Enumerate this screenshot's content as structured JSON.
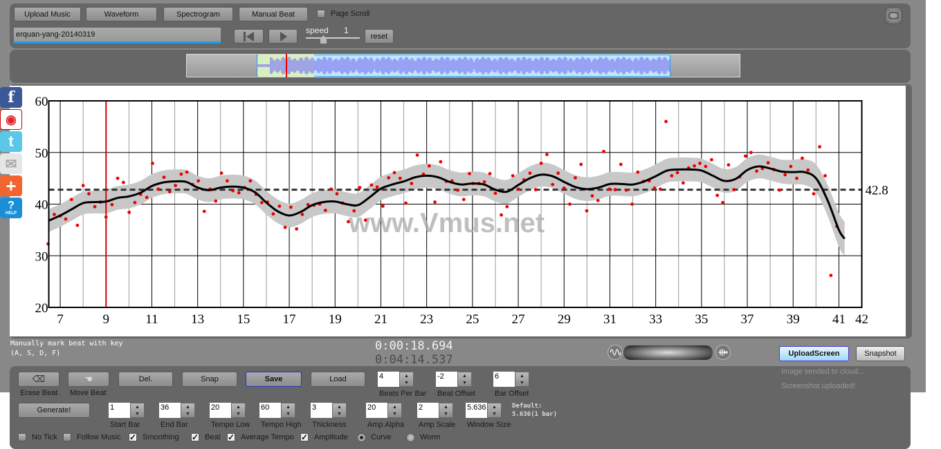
{
  "toolbar": {
    "upload_music": "Upload Music",
    "waveform": "Waveform",
    "spectrogram": "Spectrogram",
    "manual_beat": "Manual Beat",
    "page_scroll": {
      "label": "Page Scroll",
      "checked": false
    },
    "title_value": "erquan-yang-20140319",
    "speed_label": "speed",
    "speed_value": "1",
    "speed_fraction": 0.5,
    "reset": "reset"
  },
  "icons": [
    "skip-back-icon",
    "play-icon",
    "fullscreen-icon",
    "facebook-icon",
    "weibo-icon",
    "twitter-icon",
    "mail-icon",
    "plus-share-icon",
    "help-icon",
    "waveform-icon",
    "audio-wave-icon"
  ],
  "social": {
    "help_label": "HELP"
  },
  "status": {
    "hint_line1": "Manually mark beat with key",
    "hint_line2": "(A, S, D, F)",
    "current_time": "0:00:18.694",
    "total_time": "0:04:14.537",
    "upload_screen": "UploadScreen",
    "snapshot": "Snapshot",
    "msg1": "Image sended to cloud...",
    "msg2": "Screenshot uploaded!"
  },
  "controls": {
    "erase_beat": "Erase Beat",
    "move_beat": "Move Beat",
    "del": "Del.",
    "snap": "Snap",
    "save": "Save",
    "load": "Load",
    "generate": "Generate!",
    "spinners_row1": [
      {
        "label": "Beats Per Bar",
        "value": "4"
      },
      {
        "label": "Beat Offset",
        "value": "-2"
      },
      {
        "label": "Bar Offset",
        "value": "6"
      }
    ],
    "spinners_row2": [
      {
        "label": "Start Bar",
        "value": "1"
      },
      {
        "label": "End Bar",
        "value": "36"
      },
      {
        "label": "Tempo Low",
        "value": "20"
      },
      {
        "label": "Tempo High",
        "value": "60"
      },
      {
        "label": "Thickness",
        "value": "3"
      },
      {
        "label": "Amp Alpha",
        "value": "20"
      },
      {
        "label": "Amp Scale",
        "value": "2"
      },
      {
        "label": "Window Size",
        "value": "5.636"
      }
    ],
    "default_line1": "Default:",
    "default_line2": "5.636(1 bar)",
    "checks": [
      {
        "label": "No Tick",
        "checked": false
      },
      {
        "label": "Follow Music",
        "checked": false
      },
      {
        "label": "Smoothing",
        "checked": true
      },
      {
        "label": "Beat",
        "checked": true
      },
      {
        "label": "Average Tempo",
        "checked": true
      },
      {
        "label": "Amplitude",
        "checked": true
      }
    ],
    "radios": [
      {
        "label": "Curve",
        "selected": true
      },
      {
        "label": "Worm",
        "selected": false
      }
    ]
  },
  "chart_data": {
    "type": "scatter",
    "watermark": "www.Vmus.net",
    "xlim": [
      6.5,
      42
    ],
    "ylim": [
      20,
      60
    ],
    "xticks": [
      7,
      9,
      11,
      13,
      15,
      17,
      19,
      21,
      23,
      25,
      27,
      29,
      31,
      33,
      35,
      37,
      39,
      41,
      42
    ],
    "yticks": [
      20,
      30,
      40,
      50,
      60
    ],
    "grid": true,
    "cursor_bar": 9,
    "average_tempo": 42.8,
    "average_label": "42.8",
    "colors": {
      "points": "#ee0000",
      "curve": "#000000",
      "band": "#c8c8c8",
      "cursor": "#dd0000",
      "average": "#333333"
    },
    "curve": {
      "x": [
        6.5,
        7,
        7.5,
        8,
        8.5,
        9,
        9.5,
        10,
        10.5,
        11,
        11.5,
        12,
        12.5,
        13,
        13.5,
        14,
        14.5,
        15,
        15.5,
        16,
        16.5,
        17,
        17.5,
        18,
        18.5,
        19,
        19.5,
        20,
        20.5,
        21,
        21.5,
        22,
        22.5,
        23,
        23.5,
        24,
        24.5,
        25,
        25.5,
        26,
        26.5,
        27,
        27.5,
        28,
        28.5,
        29,
        29.5,
        30,
        30.5,
        31,
        31.5,
        32,
        32.5,
        33,
        33.5,
        34,
        34.5,
        35,
        35.5,
        36,
        36.5,
        37,
        37.5,
        38,
        38.5,
        39,
        39.5,
        40,
        40.5,
        41,
        41.25
      ],
      "y": [
        36.8,
        37.8,
        39,
        40.2,
        40.4,
        40.5,
        41.2,
        41.5,
        42.2,
        43.5,
        44.2,
        44.4,
        44.3,
        43.2,
        42.7,
        43.2,
        43.4,
        43.2,
        42.3,
        40.3,
        38.6,
        37.8,
        38.5,
        39.8,
        40.4,
        40.5,
        40,
        39.8,
        41.3,
        43,
        43.8,
        44.4,
        45.2,
        45.5,
        45.2,
        44.3,
        43.8,
        44,
        43.8,
        42.8,
        42.4,
        43.7,
        45,
        45.7,
        45.4,
        44.3,
        43.3,
        42.9,
        43.2,
        43.9,
        43.9,
        43.8,
        44.4,
        45.4,
        46.5,
        46.7,
        46.7,
        46.5,
        45.5,
        44.5,
        44.9,
        46.6,
        47.3,
        46.9,
        46.3,
        46.2,
        46.2,
        45,
        40.8,
        35,
        33.3
      ],
      "band_halfwidth": [
        2.2,
        2.2,
        2.2,
        2.2,
        2.2,
        2.3,
        2.3,
        2.3,
        2.3,
        2.3,
        2.3,
        2.3,
        2.3,
        2.3,
        2.3,
        2.3,
        2.3,
        2.3,
        2.3,
        2.3,
        2.3,
        2.3,
        2.3,
        2.3,
        2.3,
        2.3,
        2.3,
        2.3,
        2.3,
        2.3,
        2.3,
        2.3,
        2.3,
        2.3,
        2.3,
        2.3,
        2.3,
        2.3,
        2.3,
        2.3,
        2.3,
        2.3,
        2.3,
        2.3,
        2.3,
        2.3,
        2.3,
        2.3,
        2.3,
        2.3,
        2.3,
        2.3,
        2.3,
        2.3,
        2.3,
        2.3,
        2.3,
        2.3,
        2.3,
        2.3,
        2.3,
        2.3,
        2.3,
        2.3,
        2.3,
        2.4,
        2.5,
        2.7,
        3.0,
        3.3,
        3.3
      ]
    },
    "points": [
      [
        6.47,
        32.3
      ],
      [
        6.74,
        38.0
      ],
      [
        7.0,
        37.7
      ],
      [
        7.24,
        37.1
      ],
      [
        7.49,
        40.9
      ],
      [
        7.75,
        35.9
      ],
      [
        8.0,
        43.6
      ],
      [
        8.25,
        42.0
      ],
      [
        8.51,
        39.5
      ],
      [
        8.75,
        40.4
      ],
      [
        9.0,
        37.5
      ],
      [
        9.26,
        39.9
      ],
      [
        9.51,
        45.0
      ],
      [
        9.76,
        44.2
      ],
      [
        10.01,
        38.4
      ],
      [
        10.26,
        40.3
      ],
      [
        10.51,
        41.9
      ],
      [
        10.78,
        41.3
      ],
      [
        11.03,
        47.9
      ],
      [
        11.28,
        42.9
      ],
      [
        11.53,
        45.2
      ],
      [
        11.78,
        42.4
      ],
      [
        12.03,
        43.6
      ],
      [
        12.28,
        45.8
      ],
      [
        12.53,
        46.2
      ],
      [
        12.78,
        43.8
      ],
      [
        13.03,
        44.5
      ],
      [
        13.29,
        38.6
      ],
      [
        13.54,
        42.9
      ],
      [
        13.79,
        40.6
      ],
      [
        14.04,
        46.0
      ],
      [
        14.29,
        44.5
      ],
      [
        14.54,
        42.6
      ],
      [
        14.8,
        42.2
      ],
      [
        15.05,
        43.2
      ],
      [
        15.3,
        44.5
      ],
      [
        15.55,
        41.9
      ],
      [
        15.8,
        40.3
      ],
      [
        16.05,
        40.4
      ],
      [
        16.3,
        38.1
      ],
      [
        16.57,
        39.6
      ],
      [
        16.82,
        35.5
      ],
      [
        17.07,
        39.4
      ],
      [
        17.32,
        35.2
      ],
      [
        17.57,
        38.0
      ],
      [
        17.82,
        39.9
      ],
      [
        18.08,
        39.8
      ],
      [
        18.33,
        40.0
      ],
      [
        18.58,
        38.8
      ],
      [
        18.83,
        42.9
      ],
      [
        19.08,
        42.0
      ],
      [
        19.33,
        40.2
      ],
      [
        19.58,
        36.6
      ],
      [
        19.83,
        38.7
      ],
      [
        20.08,
        43.2
      ],
      [
        20.33,
        36.9
      ],
      [
        20.59,
        43.7
      ],
      [
        20.84,
        43.3
      ],
      [
        21.09,
        39.6
      ],
      [
        21.34,
        45.1
      ],
      [
        21.59,
        46.1
      ],
      [
        21.84,
        45.0
      ],
      [
        22.09,
        40.2
      ],
      [
        22.34,
        44.0
      ],
      [
        22.59,
        49.5
      ],
      [
        22.86,
        45.8
      ],
      [
        23.11,
        47.4
      ],
      [
        23.36,
        40.4
      ],
      [
        23.61,
        48.2
      ],
      [
        23.86,
        44.4
      ],
      [
        24.11,
        44.5
      ],
      [
        24.36,
        42.7
      ],
      [
        24.62,
        40.9
      ],
      [
        24.87,
        45.9
      ],
      [
        25.03,
        44.0
      ],
      [
        25.28,
        44.0
      ],
      [
        25.52,
        44.3
      ],
      [
        25.76,
        45.9
      ],
      [
        26.0,
        42.1
      ],
      [
        26.26,
        37.9
      ],
      [
        26.51,
        39.5
      ],
      [
        26.76,
        45.5
      ],
      [
        27.0,
        42.9
      ],
      [
        27.25,
        44.7
      ],
      [
        27.51,
        46.0
      ],
      [
        27.76,
        42.8
      ],
      [
        28.0,
        47.9
      ],
      [
        28.25,
        49.6
      ],
      [
        28.5,
        43.8
      ],
      [
        28.74,
        46.0
      ],
      [
        29.0,
        43.1
      ],
      [
        29.25,
        40.0
      ],
      [
        29.49,
        45.1
      ],
      [
        29.74,
        47.7
      ],
      [
        29.99,
        38.7
      ],
      [
        30.23,
        41.6
      ],
      [
        30.48,
        40.7
      ],
      [
        30.73,
        50.2
      ],
      [
        30.98,
        42.9
      ],
      [
        31.23,
        42.8
      ],
      [
        31.48,
        47.7
      ],
      [
        31.72,
        42.7
      ],
      [
        31.97,
        40.0
      ],
      [
        32.22,
        46.2
      ],
      [
        32.47,
        44.4
      ],
      [
        32.72,
        44.5
      ],
      [
        32.95,
        43.1
      ],
      [
        33.2,
        42.9
      ],
      [
        33.45,
        56.0
      ],
      [
        33.7,
        45.5
      ],
      [
        33.95,
        46.1
      ],
      [
        34.2,
        44.1
      ],
      [
        34.44,
        47.0
      ],
      [
        34.69,
        47.4
      ],
      [
        34.93,
        47.9
      ],
      [
        35.18,
        47.3
      ],
      [
        35.44,
        48.6
      ],
      [
        35.69,
        41.7
      ],
      [
        35.93,
        40.3
      ],
      [
        36.18,
        47.6
      ],
      [
        36.42,
        42.8
      ],
      [
        36.67,
        45.3
      ],
      [
        36.92,
        49.3
      ],
      [
        37.16,
        50.0
      ],
      [
        37.41,
        46.4
      ],
      [
        37.66,
        46.9
      ],
      [
        37.91,
        48.0
      ],
      [
        38.16,
        46.7
      ],
      [
        38.41,
        42.7
      ],
      [
        38.65,
        45.7
      ],
      [
        38.9,
        47.3
      ],
      [
        39.16,
        45.0
      ],
      [
        39.4,
        48.9
      ],
      [
        39.65,
        46.6
      ],
      [
        39.9,
        42.0
      ],
      [
        40.16,
        51.1
      ],
      [
        40.4,
        45.5
      ],
      [
        40.65,
        26.2
      ],
      [
        40.91,
        35.7
      ]
    ]
  }
}
